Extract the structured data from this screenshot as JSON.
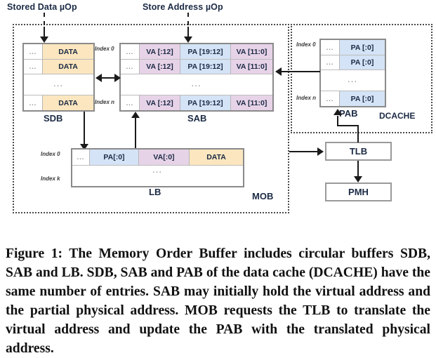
{
  "figure": {
    "sources": {
      "stored_data_uop": "Stored Data µOp",
      "store_address_uop": "Store Address µOp"
    },
    "groups": {
      "mob": "MOB",
      "dcache": "DCACHE"
    },
    "index_labels": {
      "first": "Index 0",
      "last_n": "Index n",
      "last_k": "Index k"
    },
    "ellipsis": "...",
    "tables": {
      "sdb": {
        "name": "SDB",
        "columns": [
          "...",
          "DATA"
        ],
        "rows": [
          {
            "index": "Index 0",
            "cells": [
              "...",
              "DATA"
            ]
          },
          {
            "index": "",
            "cells": [
              "...",
              "DATA"
            ]
          },
          {
            "index": "",
            "cells": [
              "..."
            ]
          },
          {
            "index": "Index n",
            "cells": [
              "...",
              "DATA"
            ]
          }
        ]
      },
      "sab": {
        "name": "SAB",
        "columns": [
          "...",
          "VA [:12]",
          "PA [19:12]",
          "VA [11:0]"
        ],
        "rows": [
          {
            "index": "Index 0",
            "cells": [
              "...",
              "VA [:12]",
              "PA [19:12]",
              "VA [11:0]"
            ]
          },
          {
            "index": "",
            "cells": [
              "...",
              "VA [:12]",
              "PA [19:12]",
              "VA [11:0]"
            ]
          },
          {
            "index": "",
            "cells": [
              "..."
            ]
          },
          {
            "index": "Index n",
            "cells": [
              "...",
              "VA [:12]",
              "PA [19:12]",
              "VA [11:0]"
            ]
          }
        ]
      },
      "pab": {
        "name": "PAB",
        "columns": [
          "...",
          "PA [:0]"
        ],
        "rows": [
          {
            "index": "Index 0",
            "cells": [
              "...",
              "PA [:0]"
            ]
          },
          {
            "index": "",
            "cells": [
              "...",
              "PA [:0]"
            ]
          },
          {
            "index": "",
            "cells": [
              "..."
            ]
          },
          {
            "index": "Index n",
            "cells": [
              "...",
              "PA [:0]"
            ]
          }
        ]
      },
      "lb": {
        "name": "LB",
        "columns": [
          "...",
          "PA[:0]",
          "VA[:0]",
          "DATA"
        ],
        "rows": [
          {
            "index": "Index 0",
            "cells": [
              "...",
              "PA[:0]",
              "VA[:0]",
              "DATA"
            ]
          },
          {
            "index": "",
            "cells": [
              "..."
            ]
          },
          {
            "index": "Index k",
            "cells": [
              ""
            ]
          }
        ]
      }
    },
    "units": {
      "tlb": "TLB",
      "pmh": "PMH"
    },
    "colors": {
      "data_fill": "#fbe6bf",
      "va_fill": "#e7d3e8",
      "pa_fill": "#d4e3f6",
      "border": "#8a8a8a",
      "connector": "#1a1a1a",
      "text": "#1b2a44"
    }
  },
  "caption": {
    "full": "Figure 1: The Memory Order Buffer includes circular buffers SDB, SAB and LB. SDB, SAB and PAB of the data cache (DCACHE) have the same number of entries. SAB may initially hold the virtual address and the partial physical address. MOB requests the TLB to translate the virtual address and update the PAB with the translated physical address."
  }
}
